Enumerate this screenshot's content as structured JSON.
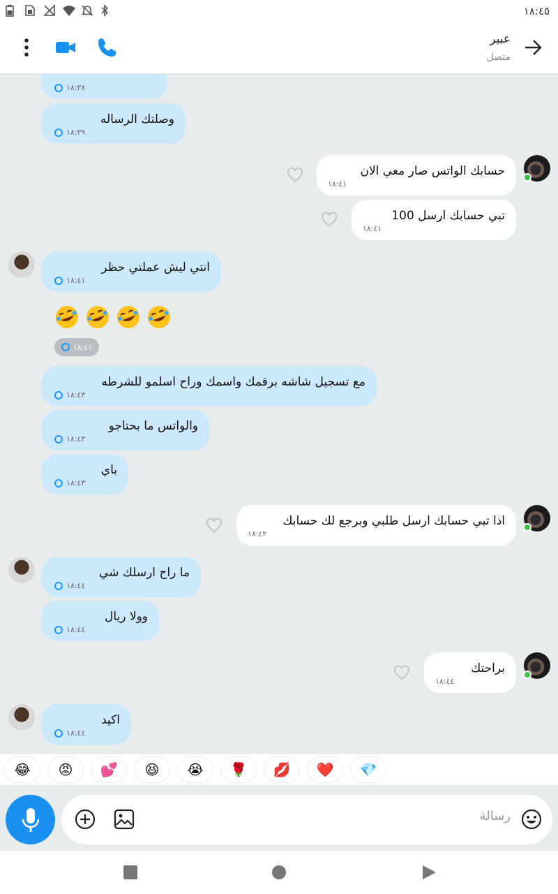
{
  "status_bar": {
    "time": "١٨:٤٥"
  },
  "header": {
    "contact_name": "عبير",
    "contact_status": "متصل"
  },
  "messages": [
    {
      "dir": "in",
      "text": "",
      "time": "١٨:٣٨"
    },
    {
      "dir": "in",
      "text": "وصلتك الرساله",
      "time": "١٨:٣٩"
    },
    {
      "dir": "out",
      "text": "حسابك الواتس صار معي الان",
      "time": "١٨:٤١"
    },
    {
      "dir": "out",
      "text": "تبي حسابك ارسل 100",
      "time": "١٨:٤١"
    },
    {
      "dir": "in",
      "text": "انتي ليش عملتي حظر",
      "time": "١٨:٤١"
    },
    {
      "dir": "in",
      "text": "🤣🤣🤣🤣",
      "time": "١٨:٤١"
    },
    {
      "dir": "in",
      "text": "مع تسجيل شاشه برقمك واسمك وراح اسلمو للشرطه",
      "time": "١٨:٤٣"
    },
    {
      "dir": "in",
      "text": "والواتس ما بحتاجو",
      "time": "١٨:٤٣"
    },
    {
      "dir": "in",
      "text": "باي",
      "time": "١٨:٤٣"
    },
    {
      "dir": "out",
      "text": "اذا تبي حسابك ارسل طلبي وبرجع لك حسابك",
      "time": "١٨:٤٢"
    },
    {
      "dir": "in",
      "text": "ما راح ارسلك شي",
      "time": "١٨:٤٤"
    },
    {
      "dir": "in",
      "text": "وولا ريال",
      "time": "١٨:٤٤"
    },
    {
      "dir": "out",
      "text": "براحتك",
      "time": "١٨:٤٤"
    },
    {
      "dir": "in",
      "text": "اكيد",
      "time": "١٨:٤٤"
    }
  ],
  "reactions": [
    "😂",
    "😡",
    "💕",
    "😆",
    "😭",
    "🌹",
    "💋",
    "❤️",
    "💎"
  ],
  "composer": {
    "placeholder": "رسالة"
  },
  "colors": {
    "accent": "#1a90f0",
    "incoming": "#cce9fb",
    "outgoing": "#ffffff",
    "background": "#e9ecec"
  }
}
